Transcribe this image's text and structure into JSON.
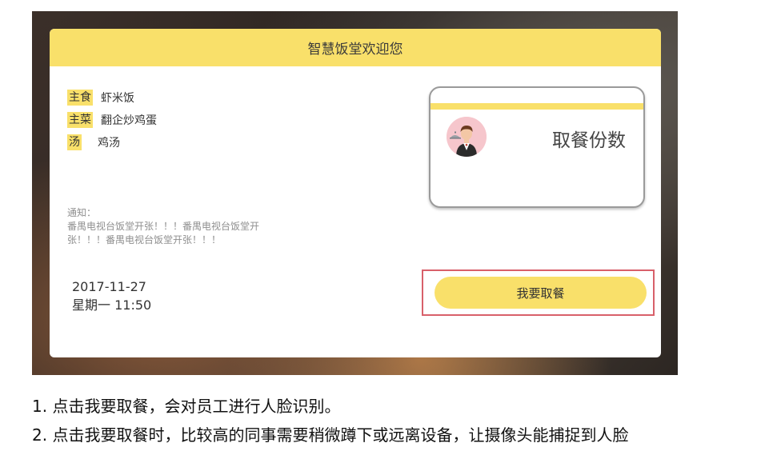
{
  "header": {
    "title": "智慧饭堂欢迎您"
  },
  "menu": {
    "items": [
      {
        "tag": "主食",
        "value": "虾米饭"
      },
      {
        "tag": "主菜",
        "value": "翻企炒鸡蛋"
      },
      {
        "tag": "汤",
        "value": "鸡汤"
      }
    ]
  },
  "notice": {
    "label": "通知：",
    "line1": "番禺电视台饭堂开张！！！番禺电视台饭堂开",
    "line2": "张！！！番禺电视台饭堂开张！！！"
  },
  "datetime": {
    "date": "2017-11-27",
    "weekday_time": "星期一 11:50"
  },
  "count_card": {
    "title": "取餐份数"
  },
  "actions": {
    "take_meal": "我要取餐"
  },
  "instructions": [
    "1. 点击我要取餐，会对员工进行人脸识别。",
    "2. 点击我要取餐时，比较高的同事需要稍微蹲下或远离设备，让摄像头能捕捉到人脸"
  ],
  "colors": {
    "accent": "#f9e06a",
    "highlight": "#d8606a"
  }
}
